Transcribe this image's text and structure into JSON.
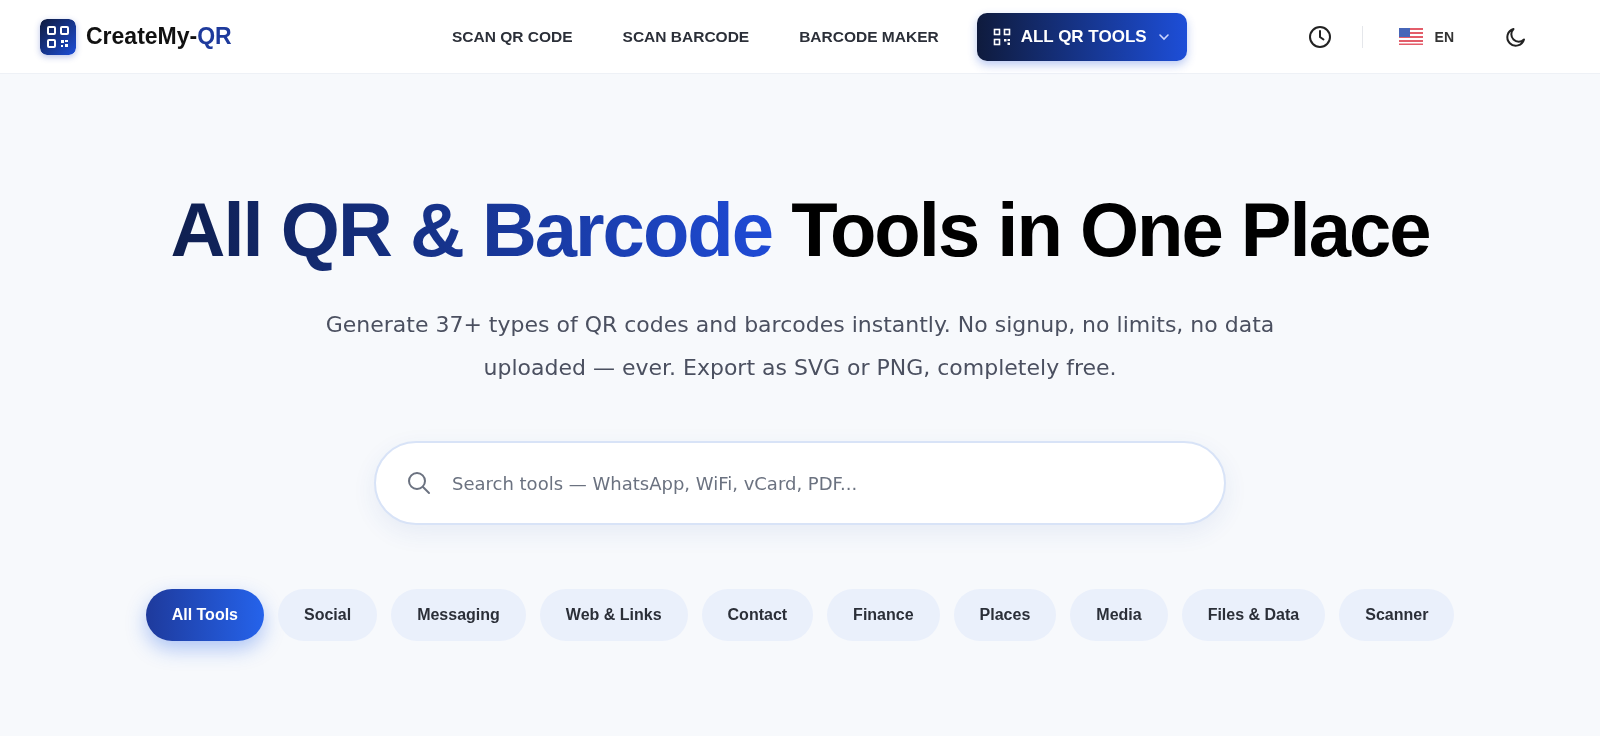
{
  "header": {
    "logo": {
      "prefix": "CreateMy-",
      "accent": "QR"
    },
    "nav": [
      {
        "label": "SCAN QR CODE",
        "selected": false
      },
      {
        "label": "SCAN BARCODE",
        "selected": false
      },
      {
        "label": "BARCODE MAKER",
        "selected": false
      },
      {
        "label": "ALL QR TOOLS",
        "selected": true
      }
    ],
    "language": "EN"
  },
  "hero": {
    "title_accent": "All QR & Barcode",
    "title_rest": "Tools in One Place",
    "subtitle": "Generate 37+ types of QR codes and barcodes instantly. No signup, no limits, no data uploaded — ever. Export as SVG or PNG, completely free.",
    "search": {
      "placeholder": "Search tools — WhatsApp, WiFi, vCard, PDF..."
    }
  },
  "categories": [
    {
      "label": "All Tools",
      "selected": true
    },
    {
      "label": "Social",
      "selected": false
    },
    {
      "label": "Messaging",
      "selected": false
    },
    {
      "label": "Web & Links",
      "selected": false
    },
    {
      "label": "Contact",
      "selected": false
    },
    {
      "label": "Finance",
      "selected": false
    },
    {
      "label": "Places",
      "selected": false
    },
    {
      "label": "Media",
      "selected": false
    },
    {
      "label": "Files & Data",
      "selected": false
    },
    {
      "label": "Scanner",
      "selected": false
    }
  ]
}
